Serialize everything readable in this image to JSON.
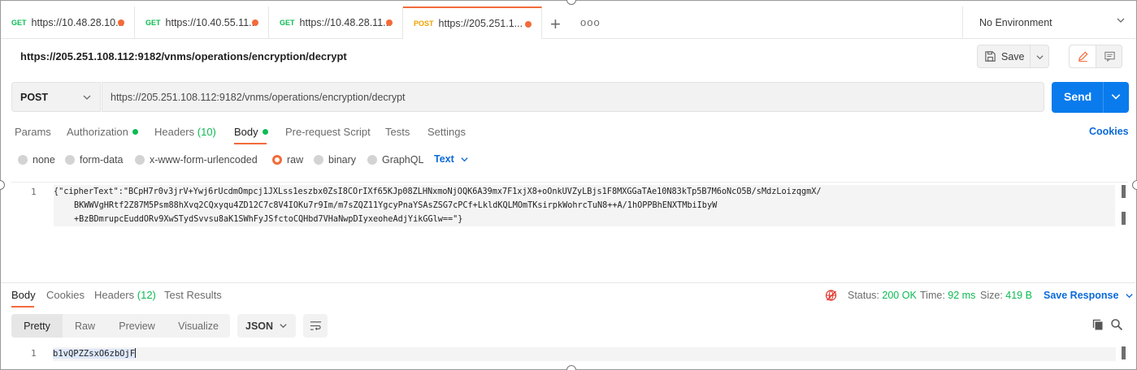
{
  "tabs": [
    {
      "method": "GET",
      "url": "https://10.48.28.10..."
    },
    {
      "method": "GET",
      "url": "https://10.40.55.11..."
    },
    {
      "method": "GET",
      "url": "https://10.48.28.11..."
    },
    {
      "method": "POST",
      "url": "https://205.251.1..."
    }
  ],
  "more_label": "ooo",
  "environment": "No Environment",
  "request": {
    "title": "https://205.251.108.112:9182/vnms/operations/encryption/decrypt",
    "save_label": "Save",
    "method": "POST",
    "url": "https://205.251.108.112:9182/vnms/operations/encryption/decrypt",
    "send_label": "Send",
    "tabs": {
      "params": "Params",
      "authorization": "Authorization",
      "headers": "Headers",
      "headers_count": "(10)",
      "body": "Body",
      "prerequest": "Pre-request Script",
      "tests": "Tests",
      "settings": "Settings"
    },
    "cookies_label": "Cookies",
    "body_types": [
      "none",
      "form-data",
      "x-www-form-urlencoded",
      "raw",
      "binary",
      "GraphQL"
    ],
    "selected_body_type": "raw",
    "text_format": "Text",
    "line_number": "1",
    "body_lines": [
      "{\"cipherText\":\"BCpH7r0v3jrV+Ywj6rUcdmOmpcj1JXLss1eszbx0ZsI8COrIXf65KJp08ZLHNxmoNjOQK6A39mx7F1xjX8+oOnkUVZyLBjs1F8MXGGaTAe10N83kTp5B7M6oNcO5B/sMdzLoizqgmX/",
      "BKWWVgHRtf2Z87M5Psm88hXvq2CQxyqu4ZD12C7c8V4IOKu7r9Im/m7sZQZ11YgcyPnaYSAsZSG7cPCf+LkldKQLMOmTKsirpkWohrcTuN8++A/1hOPPBhENXTMbiIbyW",
      "+BzBDmrupcEuddORv9XwSTydSvvsu8aK1SWhFyJSfctoCQHbd7VHaNwpDIyxeoheAdjYikGGlw==\"}"
    ]
  },
  "response": {
    "tabs": {
      "body": "Body",
      "cookies": "Cookies",
      "headers": "Headers",
      "headers_count": "(12)",
      "test_results": "Test Results"
    },
    "status_label": "Status:",
    "status_value": "200 OK",
    "time_label": "Time:",
    "time_value": "92 ms",
    "size_label": "Size:",
    "size_value": "419 B",
    "save_response_label": "Save Response",
    "views": [
      "Pretty",
      "Raw",
      "Preview",
      "Visualize"
    ],
    "format": "JSON",
    "line_number": "1",
    "body_text": "b1vQPZZsxO6zbOjF"
  },
  "colors": {
    "accent": "#f26b3a",
    "send": "#097bed",
    "get": "#0cbb52",
    "post": "#f0a100",
    "link": "#0b6ad9"
  }
}
